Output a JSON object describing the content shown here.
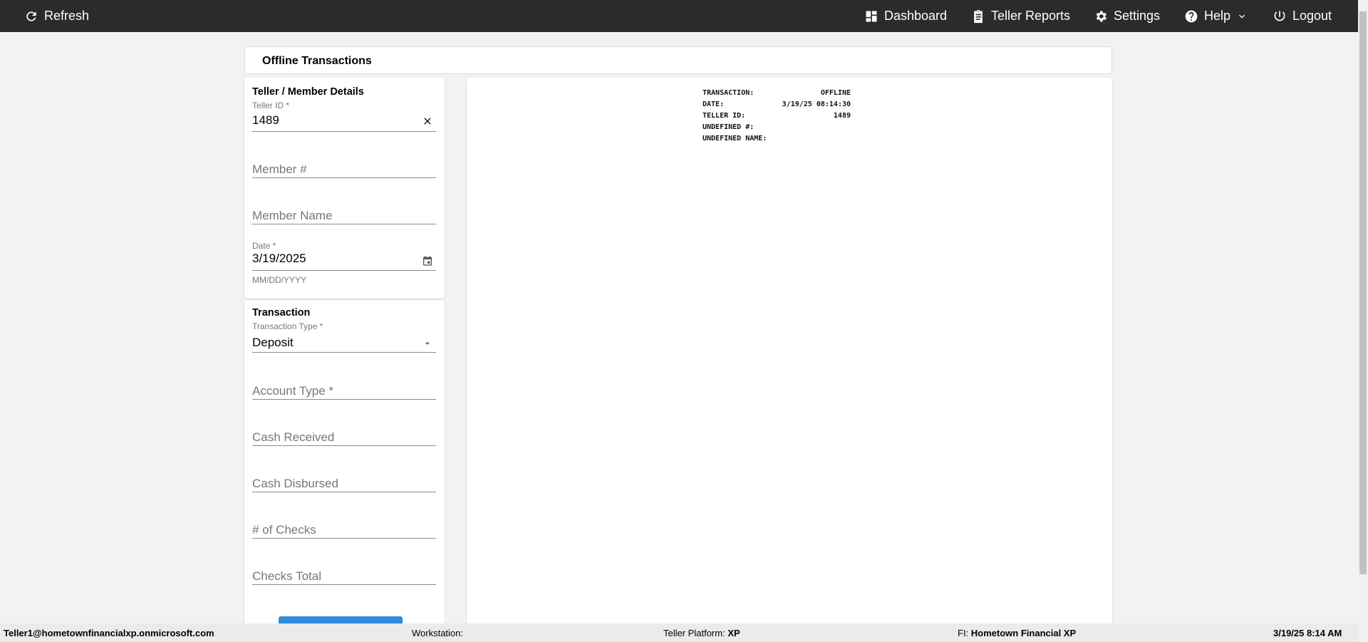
{
  "topbar": {
    "refresh": "Refresh",
    "dashboard": "Dashboard",
    "reports": "Teller Reports",
    "settings": "Settings",
    "help": "Help",
    "logout": "Logout"
  },
  "page_title": "Offline Transactions",
  "details": {
    "title": "Teller / Member Details",
    "teller_id_label": "Teller ID *",
    "teller_id_value": "1489",
    "member_no_placeholder": "Member #",
    "member_name_placeholder": "Member Name",
    "date_label": "Date *",
    "date_value": "3/19/2025",
    "date_helper": "MM/DD/YYYY"
  },
  "transaction": {
    "title": "Transaction",
    "type_label": "Transaction Type *",
    "type_value": "Deposit",
    "account_type_placeholder": "Account Type *",
    "cash_received_placeholder": "Cash Received",
    "cash_disbursed_placeholder": "Cash Disbursed",
    "checks_count_placeholder": "# of Checks",
    "checks_total_placeholder": "Checks Total"
  },
  "receipt": [
    {
      "label": "TRANSACTION:",
      "value": "OFFLINE"
    },
    {
      "label": "DATE:",
      "value": "3/19/25 08:14:30"
    },
    {
      "label": "TELLER ID:",
      "value": "1489"
    },
    {
      "label": "UNDEFINED #:",
      "value": ""
    },
    {
      "label": "UNDEFINED NAME:",
      "value": ""
    }
  ],
  "footer": {
    "user": "Teller1@hometownfinancialxp.onmicrosoft.com",
    "workstation_label": "Workstation:",
    "platform_label": "Teller Platform:",
    "platform_value": "XP",
    "fi_label": "FI:",
    "fi_value": "Hometown Financial XP",
    "datetime": "3/19/25 8:14 AM"
  },
  "colors": {
    "topbar": "#2b2b2b",
    "primary_button": "#2f8bdc"
  }
}
